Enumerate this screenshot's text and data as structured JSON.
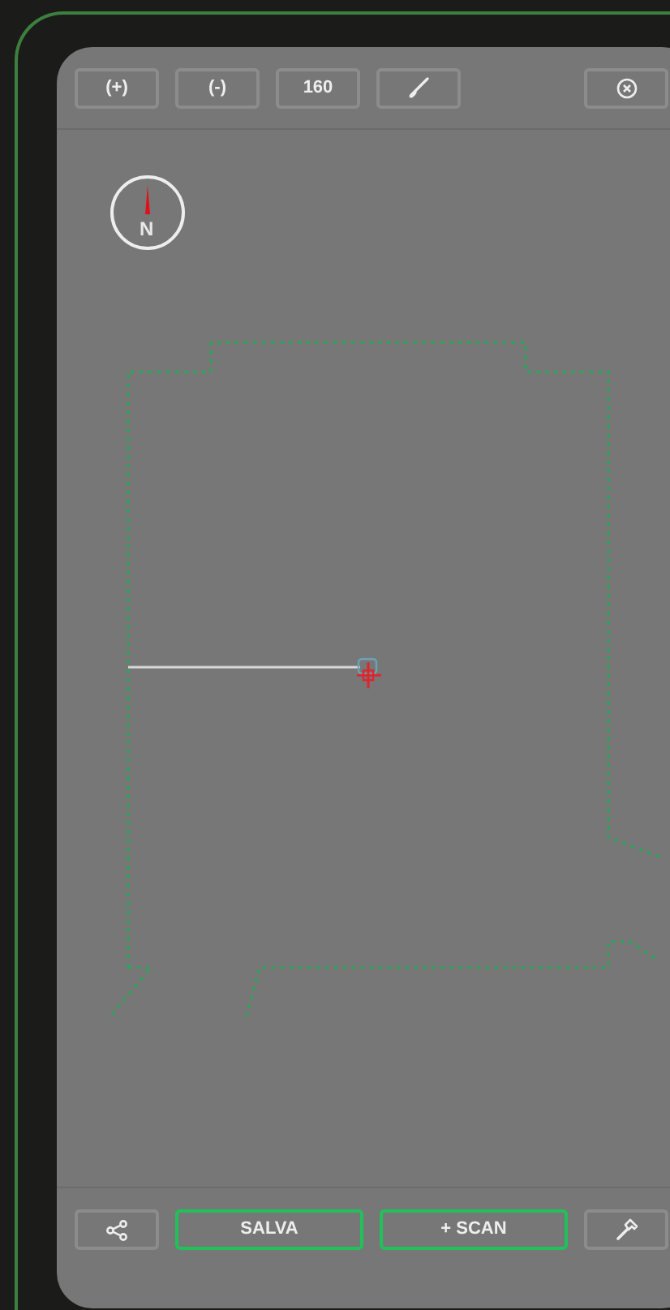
{
  "toolbar": {
    "buttons": [
      {
        "label": "(+)"
      },
      {
        "label": "(-)"
      },
      {
        "label": "160"
      }
    ]
  },
  "compass": {
    "label": "N"
  },
  "bottom_bar": {
    "buttons": [
      {
        "label": "SALVA",
        "highlighted": true
      },
      {
        "label": "+ SCAN",
        "highlighted": true
      }
    ]
  }
}
